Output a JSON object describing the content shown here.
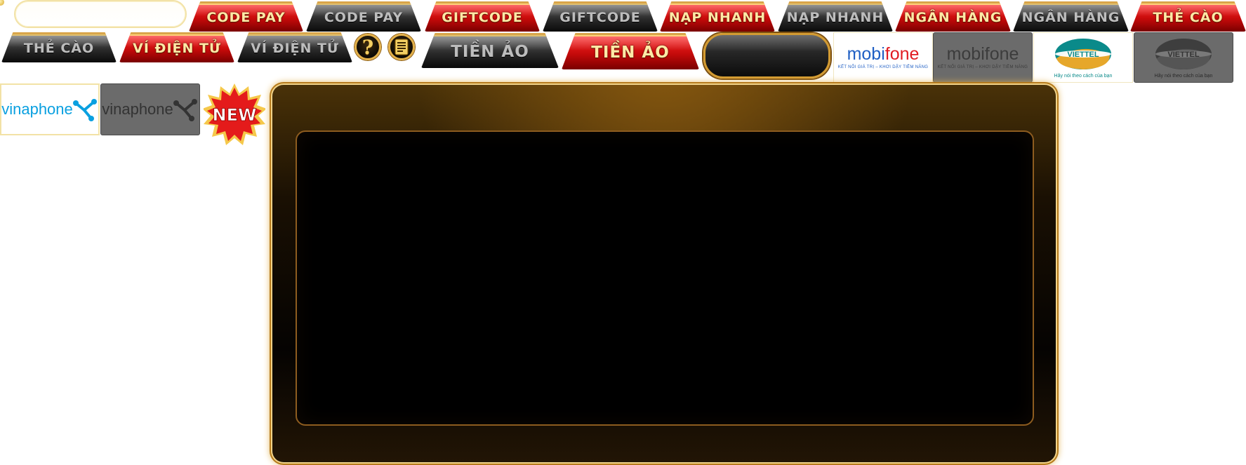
{
  "search": {
    "placeholder": ""
  },
  "row1_tabs": [
    {
      "label": "CODE PAY",
      "style": "red"
    },
    {
      "label": "CODE PAY",
      "style": "dark"
    },
    {
      "label": "GIFTCODE",
      "style": "red"
    },
    {
      "label": "GIFTCODE",
      "style": "dark"
    },
    {
      "label": "NẠP NHANH",
      "style": "red"
    },
    {
      "label": "NẠP NHANH",
      "style": "dark"
    },
    {
      "label": "NGÂN HÀNG",
      "style": "red"
    },
    {
      "label": "NGÂN HÀNG",
      "style": "dark"
    },
    {
      "label": "THẺ CÀO",
      "style": "red"
    }
  ],
  "row2_tabs": [
    {
      "label": "THẺ CÀO",
      "style": "dark"
    },
    {
      "label": "VÍ ĐIỆN TỬ",
      "style": "red"
    },
    {
      "label": "VÍ ĐIỆN TỬ",
      "style": "dark"
    },
    {
      "label": "TIỀN ẢO",
      "style": "dark"
    },
    {
      "label": "TIỀN ẢO",
      "style": "red"
    }
  ],
  "icons": {
    "help": "question-icon",
    "notes": "document-icon",
    "help_glyph": "?"
  },
  "brands": {
    "mobifone": {
      "name_prefix": "mobi",
      "name_suffix": "fone",
      "tagline": "KẾT NỐI GIÁ TRỊ – KHƠI DẬY TIỀM NĂNG"
    },
    "viettel": {
      "name": "VIETTEL",
      "tagline": "Hãy nói theo cách của bạn"
    },
    "vinaphone": {
      "name": "vinaphone"
    }
  },
  "badge": {
    "text": "NEW"
  },
  "colors": {
    "red": "#c50a0a",
    "gold": "#e2b04a",
    "dark": "#0b0b0b",
    "mobifone_blue": "#1f5fc4",
    "mobifone_red": "#e11b22",
    "viettel_teal": "#0a8a8a",
    "vinaphone_blue": "#0aa0e0"
  }
}
